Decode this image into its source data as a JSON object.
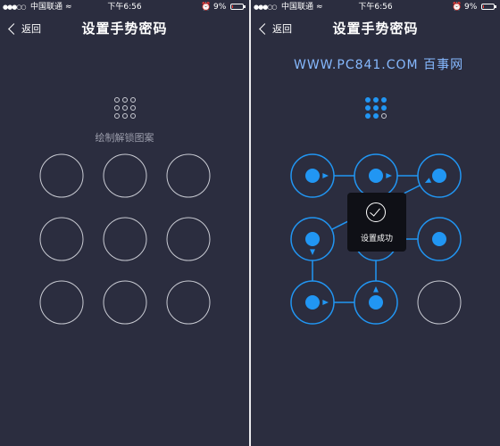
{
  "status_bar": {
    "signal": "●●●○○",
    "carrier": "中国联通",
    "time": "下午6:56",
    "alarm": "⏰",
    "battery_percent": "9%",
    "battery_level": 0.09
  },
  "nav": {
    "back_label": "返回",
    "title": "设置手势密码"
  },
  "left_screen": {
    "hint": "绘制解锁图案",
    "preview_dots_on": [
      false,
      false,
      false,
      false,
      false,
      false,
      false,
      false,
      false
    ],
    "grid_nodes_selected": [
      false,
      false,
      false,
      false,
      false,
      false,
      false,
      false,
      false
    ]
  },
  "right_screen": {
    "watermark": "WWW.PC841.COM 百事网",
    "preview_dots_on": [
      true,
      true,
      true,
      true,
      true,
      true,
      true,
      true,
      false
    ],
    "grid_nodes_selected": [
      true,
      true,
      true,
      true,
      true,
      true,
      true,
      true,
      false
    ],
    "pattern_sequence": [
      1,
      2,
      3,
      4,
      7,
      8,
      5,
      6
    ],
    "toast_text": "设置成功"
  },
  "colors": {
    "background": "#2b2d3f",
    "accent": "#2196f3",
    "ring_idle": "#c9cbd3",
    "ring_active": "#2196f3",
    "toast_bg": "#0f1016",
    "watermark": "#86b9ff",
    "battery_low": "#ff3b30"
  },
  "icons": {
    "back": "chevron-left-icon",
    "wifi": "wifi-icon",
    "alarm": "alarm-icon",
    "battery": "battery-icon",
    "success": "check-circle-icon"
  }
}
